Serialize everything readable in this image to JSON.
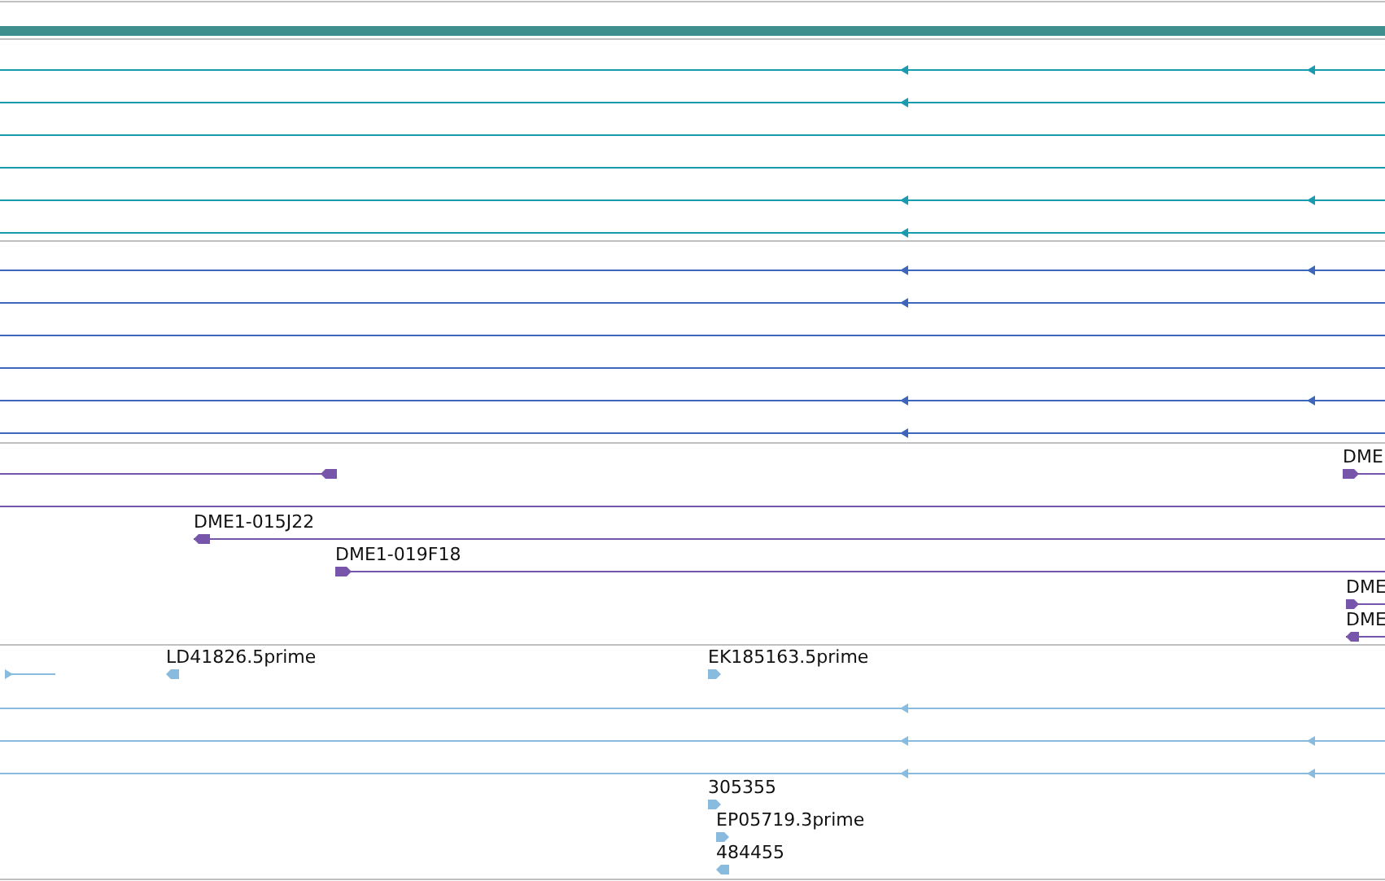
{
  "tracks": [
    {
      "kind": "coverage",
      "color": "#3f8f8f"
    },
    {
      "kind": "transcripts",
      "color": "#1a9ab0",
      "rows": [
        {
          "reverse": true
        },
        {
          "reverse": true
        },
        {
          "kind": "plain"
        },
        {
          "kind": "plain"
        },
        {
          "reverse": true
        },
        {
          "reverse": true
        }
      ]
    },
    {
      "kind": "transcripts",
      "color": "#3b66bb",
      "rows": [
        {
          "reverse": true
        },
        {
          "reverse": true
        },
        {
          "kind": "plain"
        },
        {
          "kind": "plain"
        },
        {
          "reverse": true
        },
        {
          "reverse": true
        }
      ]
    },
    {
      "kind": "features",
      "color": "#7755aa",
      "rows": [
        {
          "features": [
            {
              "kind": "glyph",
              "reverse": true
            },
            {
              "kind": "glyph",
              "label": "DME",
              "reverse": false
            }
          ]
        },
        {
          "features": [
            {
              "kind": "span"
            }
          ]
        },
        {
          "features": [
            {
              "kind": "glyph",
              "label": "DME1-015J22",
              "reverse": true
            }
          ]
        },
        {
          "features": [
            {
              "kind": "glyph",
              "label": "DME1-019F18",
              "reverse": false
            }
          ]
        },
        {
          "features": [
            {
              "kind": "glyph",
              "label": "DME",
              "reverse": false
            }
          ]
        },
        {
          "features": [
            {
              "kind": "glyph",
              "label": "DME",
              "reverse": true
            }
          ]
        }
      ]
    },
    {
      "kind": "features",
      "color": "#88bbdd",
      "rows": [
        {
          "features": [
            {
              "kind": "glyph",
              "reverse": false
            },
            {
              "kind": "glyph",
              "label": "LD41826.5prime",
              "reverse": true
            },
            {
              "kind": "glyph",
              "label": "EK185163.5prime",
              "reverse": false
            }
          ]
        },
        {
          "features": [
            {
              "kind": "glyph",
              "reverse": true
            }
          ]
        },
        {
          "features": [
            {
              "kind": "glyph",
              "reverse": true
            }
          ]
        },
        {
          "features": [
            {
              "kind": "glyph",
              "reverse": true
            }
          ]
        },
        {
          "features": [
            {
              "kind": "glyph",
              "label": "305355",
              "reverse": false
            }
          ]
        },
        {
          "features": [
            {
              "kind": "glyph",
              "label": "EP05719.3prime",
              "reverse": false
            }
          ]
        },
        {
          "features": [
            {
              "kind": "glyph",
              "label": "484455",
              "reverse": true
            }
          ]
        }
      ]
    }
  ]
}
